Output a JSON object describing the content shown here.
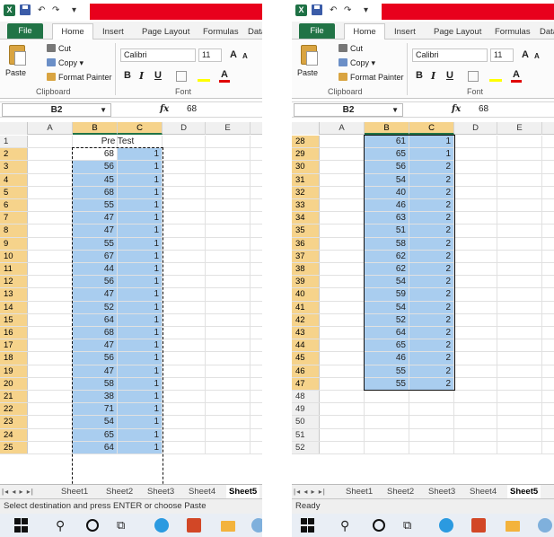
{
  "qat": {
    "undo": "↶",
    "redo": "↷",
    "customize": "▾"
  },
  "tabs": [
    "File",
    "Home",
    "Insert",
    "Page Layout",
    "Formulas",
    "Data"
  ],
  "ribbon": {
    "paste": "Paste",
    "cut": "Cut",
    "copy": "Copy",
    "format_painter": "Format Painter",
    "clipboard_group": "Clipboard",
    "font_group": "Font",
    "font_name": "Calibri",
    "font_size": "11",
    "bold": "B",
    "italic": "I",
    "underline": "U",
    "grow": "A",
    "shrink": "A"
  },
  "formula_bar": {
    "cell_ref": "B2",
    "fx": "fx",
    "value": "68"
  },
  "columns": [
    "A",
    "B",
    "C",
    "D",
    "E",
    "F"
  ],
  "left_panel": {
    "title_text": "Pre Test",
    "status": "Select destination and press ENTER or choose Paste",
    "rows": [
      {
        "r": "1",
        "b": "",
        "c": ""
      },
      {
        "r": "2",
        "b": "68",
        "c": "1"
      },
      {
        "r": "3",
        "b": "56",
        "c": "1"
      },
      {
        "r": "4",
        "b": "45",
        "c": "1"
      },
      {
        "r": "5",
        "b": "68",
        "c": "1"
      },
      {
        "r": "6",
        "b": "55",
        "c": "1"
      },
      {
        "r": "7",
        "b": "47",
        "c": "1"
      },
      {
        "r": "8",
        "b": "47",
        "c": "1"
      },
      {
        "r": "9",
        "b": "55",
        "c": "1"
      },
      {
        "r": "10",
        "b": "67",
        "c": "1"
      },
      {
        "r": "11",
        "b": "44",
        "c": "1"
      },
      {
        "r": "12",
        "b": "56",
        "c": "1"
      },
      {
        "r": "13",
        "b": "47",
        "c": "1"
      },
      {
        "r": "14",
        "b": "52",
        "c": "1"
      },
      {
        "r": "15",
        "b": "64",
        "c": "1"
      },
      {
        "r": "16",
        "b": "68",
        "c": "1"
      },
      {
        "r": "17",
        "b": "47",
        "c": "1"
      },
      {
        "r": "18",
        "b": "56",
        "c": "1"
      },
      {
        "r": "19",
        "b": "47",
        "c": "1"
      },
      {
        "r": "20",
        "b": "58",
        "c": "1"
      },
      {
        "r": "21",
        "b": "38",
        "c": "1"
      },
      {
        "r": "22",
        "b": "71",
        "c": "1"
      },
      {
        "r": "23",
        "b": "54",
        "c": "1"
      },
      {
        "r": "24",
        "b": "65",
        "c": "1"
      },
      {
        "r": "25",
        "b": "64",
        "c": "1"
      }
    ]
  },
  "right_panel": {
    "status": "Ready",
    "rows": [
      {
        "r": "28",
        "b": "61",
        "c": "1"
      },
      {
        "r": "29",
        "b": "65",
        "c": "1"
      },
      {
        "r": "30",
        "b": "56",
        "c": "2"
      },
      {
        "r": "31",
        "b": "54",
        "c": "2"
      },
      {
        "r": "32",
        "b": "40",
        "c": "2"
      },
      {
        "r": "33",
        "b": "46",
        "c": "2"
      },
      {
        "r": "34",
        "b": "63",
        "c": "2"
      },
      {
        "r": "35",
        "b": "51",
        "c": "2"
      },
      {
        "r": "36",
        "b": "58",
        "c": "2"
      },
      {
        "r": "37",
        "b": "62",
        "c": "2"
      },
      {
        "r": "38",
        "b": "62",
        "c": "2"
      },
      {
        "r": "39",
        "b": "54",
        "c": "2"
      },
      {
        "r": "40",
        "b": "59",
        "c": "2"
      },
      {
        "r": "41",
        "b": "54",
        "c": "2"
      },
      {
        "r": "42",
        "b": "52",
        "c": "2"
      },
      {
        "r": "43",
        "b": "64",
        "c": "2"
      },
      {
        "r": "44",
        "b": "65",
        "c": "2"
      },
      {
        "r": "45",
        "b": "46",
        "c": "2"
      },
      {
        "r": "46",
        "b": "55",
        "c": "2"
      },
      {
        "r": "47",
        "b": "55",
        "c": "2"
      },
      {
        "r": "48",
        "b": "",
        "c": ""
      },
      {
        "r": "49",
        "b": "",
        "c": ""
      },
      {
        "r": "50",
        "b": "",
        "c": ""
      },
      {
        "r": "51",
        "b": "",
        "c": ""
      },
      {
        "r": "52",
        "b": "",
        "c": ""
      }
    ]
  },
  "sheet_tabs": [
    "Sheet1",
    "Sheet2",
    "Sheet3",
    "Sheet4",
    "Sheet5"
  ],
  "colors": {
    "excel_green": "#217346",
    "title_red": "#e8001c",
    "selection": "#a9cdef",
    "header_highlight": "#f6d38b"
  }
}
